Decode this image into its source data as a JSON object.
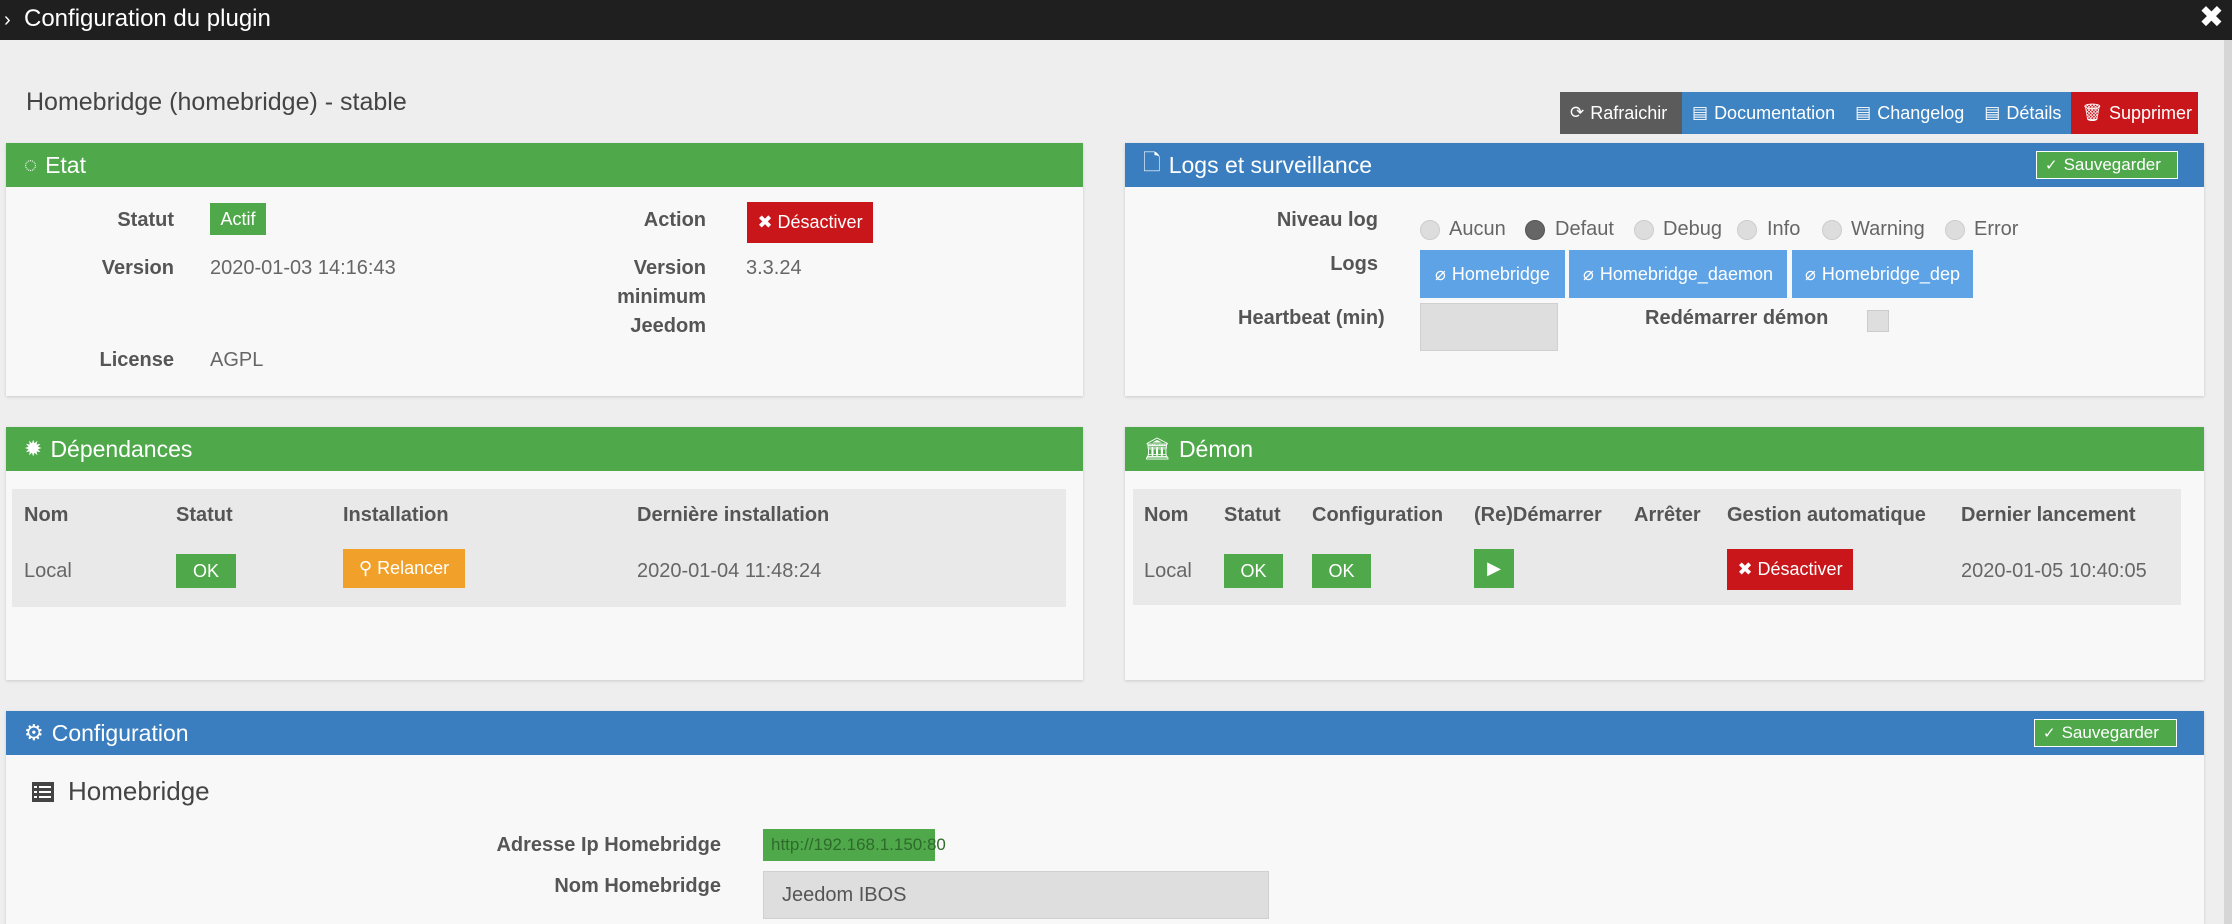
{
  "window": {
    "title": "Configuration du plugin",
    "close": "✖"
  },
  "plugin_name": "Homebridge (homebridge) - stable",
  "toolbar": {
    "refresh": "Rafraichir",
    "documentation": "Documentation",
    "changelog": "Changelog",
    "details": "Détails",
    "delete": "Supprimer"
  },
  "etat": {
    "title": "Etat",
    "statut_label": "Statut",
    "statut_value": "Actif",
    "action_label": "Action",
    "action_button": "Désactiver",
    "version_label": "Version",
    "version_value": "2020-01-03 14:16:43",
    "version_min_label_1": "Version",
    "version_min_label_2": "minimum",
    "version_min_label_3": "Jeedom",
    "version_min_value": "3.3.24",
    "license_label": "License",
    "license_value": "AGPL"
  },
  "logs": {
    "title": "Logs et surveillance",
    "save": "Sauvegarder",
    "niveau_label": "Niveau log",
    "levels": [
      "Aucun",
      "Defaut",
      "Debug",
      "Info",
      "Warning",
      "Error"
    ],
    "selected_level": "Defaut",
    "logs_label": "Logs",
    "log_buttons": [
      "Homebridge",
      "Homebridge_daemon",
      "Homebridge_dep"
    ],
    "heartbeat_label": "Heartbeat (min)",
    "heartbeat_value": "",
    "restart_label": "Redémarrer démon"
  },
  "dependances": {
    "title": "Dépendances",
    "headers": [
      "Nom",
      "Statut",
      "Installation",
      "Dernière installation"
    ],
    "row": {
      "nom": "Local",
      "statut": "OK",
      "installation": "Relancer",
      "derniere": "2020-01-04 11:48:24"
    }
  },
  "demon": {
    "title": "Démon",
    "headers": [
      "Nom",
      "Statut",
      "Configuration",
      "(Re)Démarrer",
      "Arrêter",
      "Gestion automatique",
      "Dernier lancement"
    ],
    "row": {
      "nom": "Local",
      "statut": "OK",
      "configuration": "OK",
      "gestion": "Désactiver",
      "dernier": "2020-01-05 10:40:05"
    }
  },
  "configuration": {
    "title": "Configuration",
    "save": "Sauvegarder",
    "section": "Homebridge",
    "ip_label": "Adresse Ip Homebridge",
    "ip_value": "http://192.168.1.150:80",
    "name_label": "Nom Homebridge",
    "name_value": "Jeedom IBOS"
  },
  "colors": {
    "green": "#4fa94b",
    "blue": "#3a7ebf",
    "red": "#c9161b",
    "orange": "#f1a12a",
    "light_blue": "#5ea3e6"
  }
}
